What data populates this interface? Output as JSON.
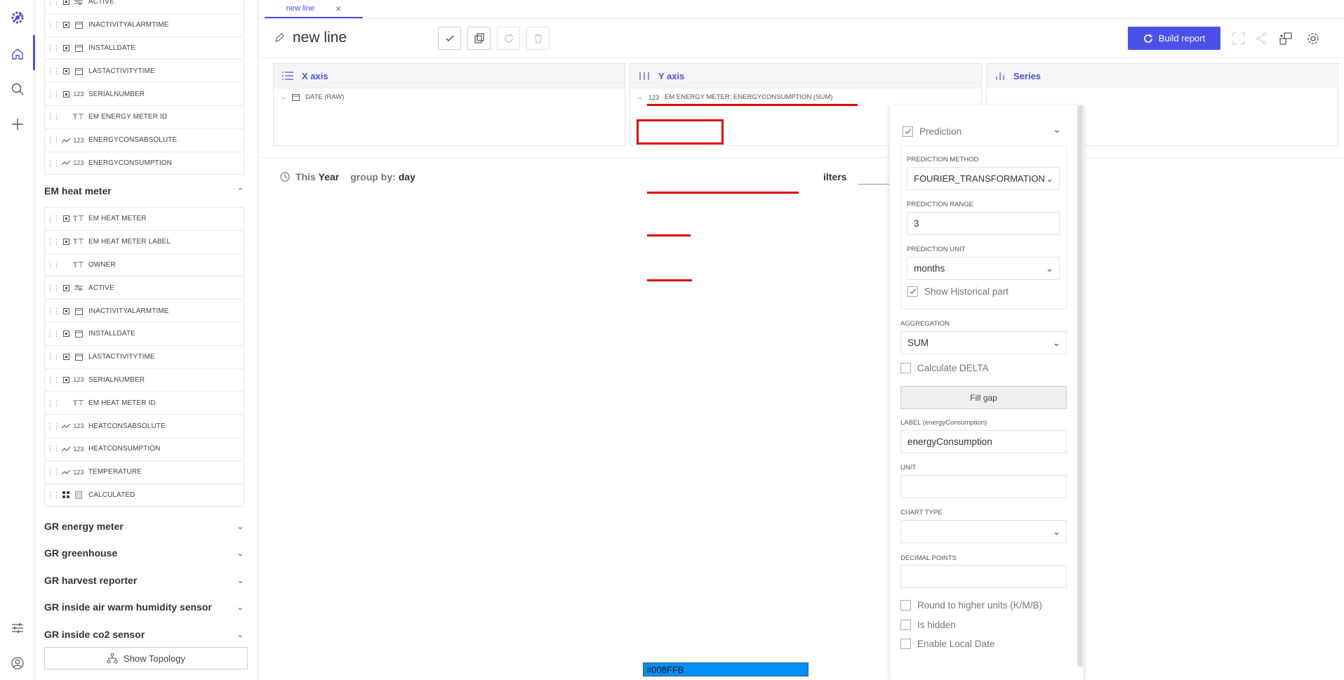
{
  "rail": {
    "icons": [
      "app-logo-icon",
      "home-icon",
      "search-icon",
      "add-icon",
      "settings-sliders-icon",
      "user-icon"
    ]
  },
  "sidebar": {
    "top_fields": [
      {
        "label": "ACTIVE",
        "type": "toggle"
      },
      {
        "label": "INACTIVITYALARMTIME",
        "type": "date"
      },
      {
        "label": "INSTALLDATE",
        "type": "date"
      },
      {
        "label": "LASTACTIVITYTIME",
        "type": "date"
      },
      {
        "label": "SERIALNUMBER",
        "type": "number"
      },
      {
        "label": "EM ENERGY METER ID",
        "type": "text"
      },
      {
        "label": "ENERGYCONSABSOLUTE",
        "type": "number"
      },
      {
        "label": "ENERGYCONSUMPTION",
        "type": "number"
      }
    ],
    "group_heat": {
      "title": "EM heat meter",
      "expanded": true,
      "fields": [
        {
          "label": "EM HEAT METER",
          "type": "text"
        },
        {
          "label": "EM HEAT METER LABEL",
          "type": "text"
        },
        {
          "label": "OWNER",
          "type": "text"
        },
        {
          "label": "ACTIVE",
          "type": "toggle"
        },
        {
          "label": "INACTIVITYALARMTIME",
          "type": "date"
        },
        {
          "label": "INSTALLDATE",
          "type": "date"
        },
        {
          "label": "LASTACTIVITYTIME",
          "type": "date"
        },
        {
          "label": "SERIALNUMBER",
          "type": "number"
        },
        {
          "label": "EM HEAT METER ID",
          "type": "text"
        },
        {
          "label": "HEATCONSABSOLUTE",
          "type": "number"
        },
        {
          "label": "HEATCONSUMPTION",
          "type": "number"
        },
        {
          "label": "TEMPERATURE",
          "type": "number"
        },
        {
          "label": "CALCULATED",
          "type": "calc"
        }
      ]
    },
    "groups": [
      "GR energy meter",
      "GR greenhouse",
      "GR harvest reporter",
      "GR inside air warm humidity sensor",
      "GR inside co2 sensor"
    ],
    "show_topology": "Show Topology"
  },
  "tab": {
    "label": "new line"
  },
  "title": "new line",
  "build_report": "Build report",
  "panels": {
    "x_axis": {
      "title": "X axis",
      "item": "DATE (RAW)"
    },
    "y_axis": {
      "title": "Y axis",
      "item": "EM ENERGY METER: ENERGYCONSUMPTION (SUM)"
    },
    "series": {
      "title": "Series"
    }
  },
  "filters": {
    "period_1": "This",
    "period_2": "Year",
    "group_by_label": "group by:",
    "group_by_value": "day",
    "filters_label": "ilters"
  },
  "dropdown": {
    "prediction_label": "Prediction",
    "prediction_checked": true,
    "prediction_method_label": "PREDICTION METHOD",
    "prediction_method_value": "FOURIER_TRANSFORMATION",
    "prediction_range_label": "PREDICTION RANGE",
    "prediction_range_value": "3",
    "prediction_unit_label": "PREDICTION UNIT",
    "prediction_unit_value": "months",
    "show_historical_label": "Show Historical part",
    "show_historical_checked": true,
    "aggregation_label": "AGGREGATION",
    "aggregation_value": "SUM",
    "calc_delta_label": "Calculate DELTA",
    "fill_gap_label": "Fill gap",
    "series_label_label": "LABEL (energyConsumption)",
    "series_label_value": "energyConsumption",
    "unit_label": "UNIT",
    "unit_value": "",
    "chart_type_label": "CHART TYPE",
    "chart_type_value": "",
    "decimal_points_label": "DECIMAL POINTS",
    "decimal_points_value": "",
    "round_label": "Round to higher units (K/M/B)",
    "hidden_label": "Is hidden",
    "local_date_label": "Enable Local Date",
    "color_value": "#008FFB"
  }
}
